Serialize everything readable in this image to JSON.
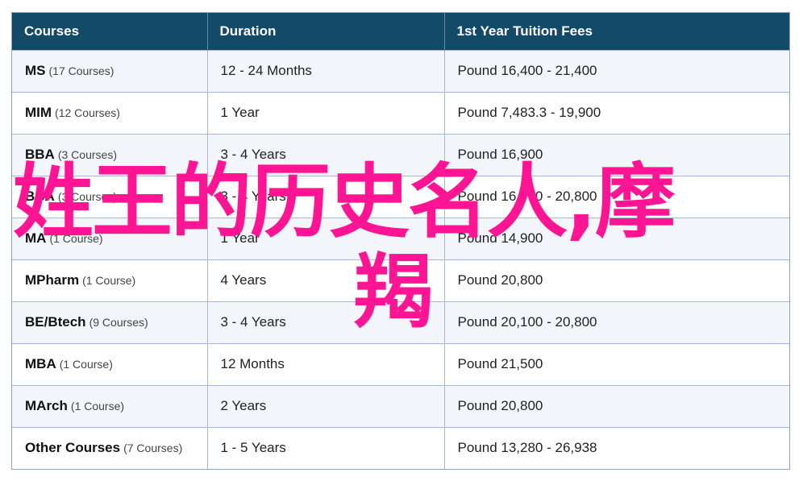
{
  "table": {
    "headers": [
      "Courses",
      "Duration",
      "1st Year Tuition Fees"
    ],
    "rows": [
      {
        "course": "MS",
        "count": "(17 Courses)",
        "duration": "12 - 24 Months",
        "fees": "Pound 16,400 - 21,400"
      },
      {
        "course": "MIM",
        "count": "(12 Courses)",
        "duration": "1 Year",
        "fees": "Pound 7,483.3 - 19,900"
      },
      {
        "course": "BBA",
        "count": "(3 Courses)",
        "duration": "3 - 4 Years",
        "fees": "Pound 16,900"
      },
      {
        "course": "BBA",
        "count": "(3 Courses)",
        "duration": "3 - 4 Years",
        "fees": "Pound 16,900 - 20,800"
      },
      {
        "course": "MA",
        "count": "(1 Course)",
        "duration": "1 Year",
        "fees": "Pound 14,900"
      },
      {
        "course": "MPharm",
        "count": "(1 Course)",
        "duration": "4 Years",
        "fees": "Pound 20,800"
      },
      {
        "course": "BE/Btech",
        "count": "(9 Courses)",
        "duration": "3 - 4 Years",
        "fees": "Pound 20,100 - 20,800"
      },
      {
        "course": "MBA",
        "count": "(1 Course)",
        "duration": "12 Months",
        "fees": "Pound 21,500"
      },
      {
        "course": "MArch",
        "count": "(1 Course)",
        "duration": "2 Years",
        "fees": "Pound 20,800"
      },
      {
        "course": "Other Courses",
        "count": "(7 Courses)",
        "duration": "1 - 5 Years",
        "fees": "Pound 13,280 - 26,938"
      }
    ]
  },
  "overlay": {
    "line1": "姓王的历史名人,摩",
    "line2": "羯",
    "color": "#ff1493"
  },
  "colors": {
    "header_bg": "#124a68",
    "row_alt_bg": "#f2f6fa"
  }
}
